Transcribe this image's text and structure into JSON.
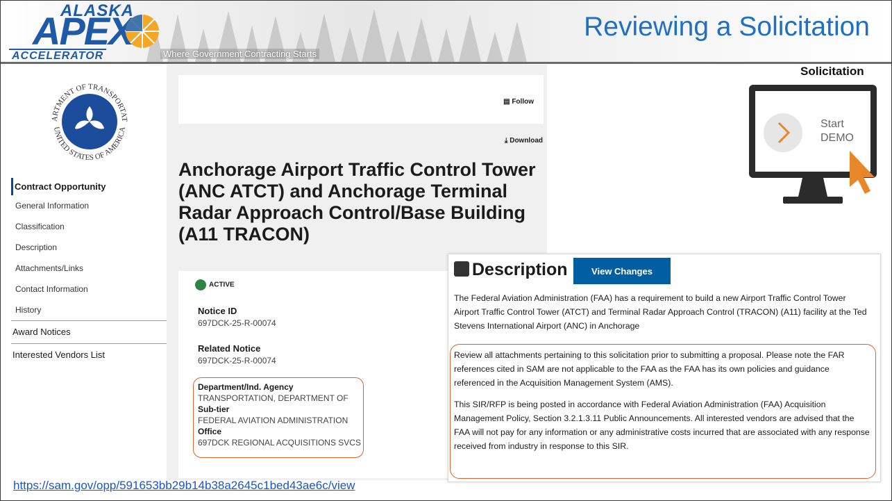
{
  "header": {
    "logo_top": "ALASKA",
    "logo_main": "APEX",
    "logo_bottom": "ACCELERATOR",
    "tagline": "Where Government Contracting Starts",
    "slide_title": "Reviewing a Solicitation"
  },
  "seal": {
    "top_text": "DEPARTMENT OF TRANSPORTATION",
    "bottom_text": "UNITED STATES OF AMERICA"
  },
  "sidebar": {
    "section_title": "Contract Opportunity",
    "items": [
      "General Information",
      "Classification",
      "Description",
      "Attachments/Links",
      "Contact Information",
      "History"
    ],
    "top_links": [
      "Award Notices",
      "Interested Vendors List"
    ]
  },
  "actions": {
    "follow": "Follow",
    "download": "Download"
  },
  "opportunity": {
    "title": "Anchorage Airport Traffic Control Tower (ANC ATCT) and Anchorage Terminal Radar Approach Control/Base Building (A11 TRACON)",
    "status": "ACTIVE",
    "notice_id_label": "Notice ID",
    "notice_id": "697DCK-25-R-00074",
    "related_notice_label": "Related Notice",
    "related_notice": "697DCK-25-R-00074",
    "department_label": "Department/Ind. Agency",
    "department": "TRANSPORTATION, DEPARTMENT OF",
    "subtier_label": "Sub-tier",
    "subtier": "FEDERAL AVIATION ADMINISTRATION",
    "office_label": "Office",
    "office": "697DCK REGIONAL ACQUISITIONS SVCS"
  },
  "description": {
    "heading": "Description",
    "view_changes": "View Changes",
    "p1": "The Federal Aviation Administration (FAA) has a requirement to build a new Airport Traffic Control Tower Airport Traffic Control Tower (ATCT) and Terminal Radar Approach Control (TRACON) (A11) facility at the Ted Stevens International Airport (ANC) in Anchorage",
    "p2": "Review all attachments pertaining to this solicitation prior to submitting a proposal. Please note the FAR references cited in SAM are not applicable to the FAA as the FAA has its own policies and guidance referenced in the Acquisition Management System (AMS).",
    "p3": "This SIR/RFP is being posted in accordance with Federal Aviation Administration (FAA) Acquisition Management Policy, Section 3.2.1.3.11 Public Announcements. All interested vendors are advised that the FAA will not pay for any information or any administrative costs incurred that are associated with any response received from industry in response to this SIR."
  },
  "demo": {
    "label": "Solicitation",
    "start": "Start",
    "demo": "DEMO"
  },
  "footer": {
    "url": "https://sam.gov/opp/591653bb29b14b38a2645c1bed43ae6c/view"
  },
  "colors": {
    "title_blue": "#1f6fc4",
    "logo_blue": "#1f5aa6",
    "button_blue": "#005ea2",
    "highlight_orange": "#d9642b",
    "active_green": "#2e8540",
    "cursor_orange": "#e8862a"
  }
}
